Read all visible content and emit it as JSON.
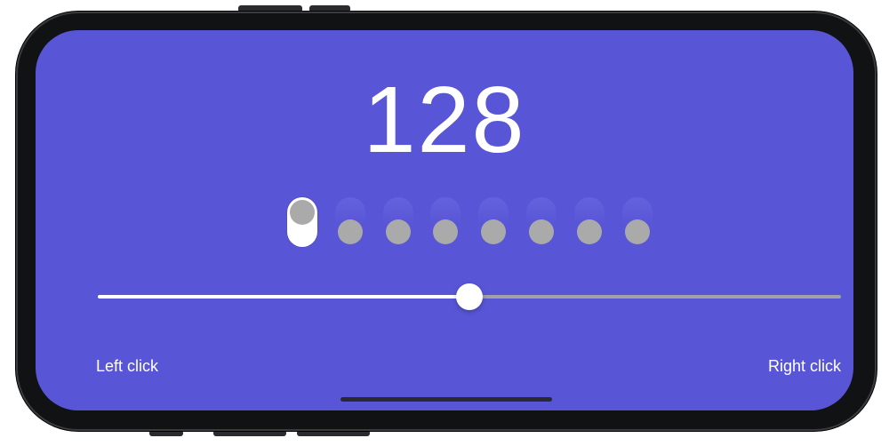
{
  "counter": {
    "value": "128"
  },
  "bits": {
    "states": [
      1,
      0,
      0,
      0,
      0,
      0,
      0,
      0
    ]
  },
  "slider": {
    "value_fraction": 0.5
  },
  "labels": {
    "left_click": "Left click",
    "right_click": "Right click"
  },
  "colors": {
    "screen_background": "#5856d6",
    "bit_on": "#ffffff",
    "bit_knob": "#aaaaaa",
    "slider_fill": "#ffffff",
    "slider_rest": "#a0a0a8"
  }
}
